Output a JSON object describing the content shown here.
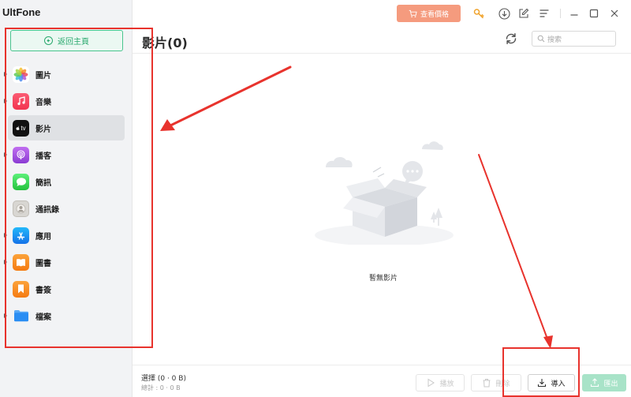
{
  "app": {
    "title": "UltFone"
  },
  "sidebar": {
    "back_label": "返回主頁",
    "items": [
      {
        "label": "圖片",
        "icon": "photos-icon"
      },
      {
        "label": "音樂",
        "icon": "music-icon"
      },
      {
        "label": "影片",
        "icon": "tv-icon",
        "active": true
      },
      {
        "label": "播客",
        "icon": "podcast-icon"
      },
      {
        "label": "簡訊",
        "icon": "messages-icon"
      },
      {
        "label": "通訊錄",
        "icon": "contacts-icon"
      },
      {
        "label": "應用",
        "icon": "appstore-icon"
      },
      {
        "label": "圖書",
        "icon": "books-icon"
      },
      {
        "label": "書簽",
        "icon": "bookmark-icon"
      },
      {
        "label": "檔案",
        "icon": "folder-icon"
      }
    ]
  },
  "topbar": {
    "price_label": "查看價格",
    "tv_icon_text": "tv"
  },
  "header": {
    "title": "影片(0)",
    "search_placeholder": "搜索"
  },
  "main": {
    "empty_text": "暫無影片"
  },
  "footer": {
    "selected": "選擇 (0 · 0 B)",
    "total": "總計 : 0 · 0 B",
    "play_label": "播放",
    "delete_label": "刪除",
    "import_label": "導入",
    "export_label": "匯出"
  },
  "colors": {
    "accent_green": "#49c48e",
    "price_orange": "#f59b7e",
    "annotation_red": "#e8332d"
  }
}
